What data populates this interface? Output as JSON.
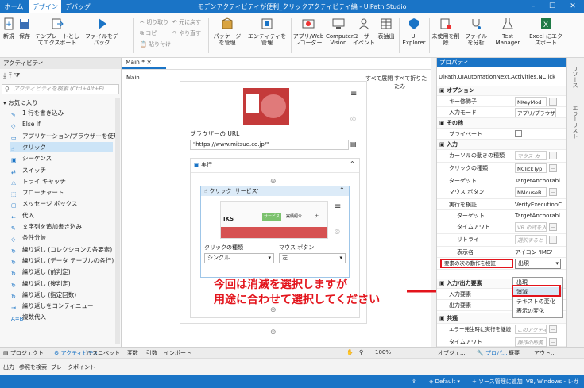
{
  "app": {
    "title": "モデンアクティビティが便利_クリックアクティビティ編 - UiPath Studio",
    "tabs": [
      "ホーム",
      "デザイン",
      "デバッグ"
    ],
    "active_tab": "デザイン"
  },
  "ribbon": {
    "new": "新規",
    "save": "保存",
    "export_template": "テンプレートとしてエクスポート",
    "debug_file": "ファイルをデバッグ",
    "cut": "切り取り",
    "copy": "コピー",
    "paste": "貼り付け",
    "undo": "元に戻す",
    "redo": "やり直す",
    "manage_packages": "パッケージを管理",
    "manage_entities": "エンティティを管理",
    "app_web_recorder": "アプリ/Web レコーダー",
    "computer_vision": "Computer Vision",
    "user_events": "ユーザー イベント",
    "table_extract": "表抽出",
    "ui_explorer": "UI Explorer",
    "remove_unused": "未使用を削除",
    "analyze_file": "ファイルを分析",
    "test_manager": "Test Manager",
    "excel_export": "Excel にエクスポート"
  },
  "activities": {
    "header": "アクティビティ",
    "search_placeholder": "アクティビティを検索 (Ctrl+Alt+F)",
    "favorites": "お気に入り",
    "items": [
      "1 行を書き込み",
      "Else If",
      "アプリケーション/ブラウザーを使用",
      "クリック",
      "シーケンス",
      "スイッチ",
      "トライ キャッチ",
      "フローチャート",
      "メッセージ ボックス",
      "代入",
      "文字列を追加書き込み",
      "条件分岐",
      "繰り返し (コレクションの各要素)",
      "繰り返し (データ テーブルの各行)",
      "繰り返し (前判定)",
      "繰り返し (後判定)",
      "繰り返し (指定回数)",
      "繰り返しをコンティニュー",
      "複数代入"
    ]
  },
  "designer": {
    "doc_tab": "Main *",
    "breadcrumb": "Main",
    "expand_all": "すべて展開",
    "collapse_all": "すべて折りたたみ",
    "browser_url_label": "ブラウザーの URL",
    "browser_url_value": "\"https://www.mitsue.co.jp/\"",
    "do_label": "実行",
    "click_activity_title": "クリック 'サービス'",
    "click_type_label": "クリックの種類",
    "click_type_value": "シングル",
    "mouse_button_label": "マウス ボタン",
    "mouse_button_value": "左",
    "thumb_brand": "IKS",
    "thumb_tabs": [
      "サービス",
      "実績紹介",
      "ナ"
    ],
    "bottom_tabs": [
      "変数",
      "引数",
      "インポート"
    ],
    "zoom": "100%"
  },
  "callout": {
    "line1": "今回は消滅を選択しますが",
    "line2": "用途に合わせて選択してください"
  },
  "properties": {
    "header": "プロパティ",
    "class_name": "UiPath.UIAutomationNext.Activities.NClick",
    "categories": {
      "options": "オプション",
      "misc": "その他",
      "input": "入力",
      "io_elements": "入力/出力要素",
      "common": "共通"
    },
    "rows": {
      "modifier_keys": {
        "label": "キー修飾子",
        "value": "NKeyMod"
      },
      "input_mode": {
        "label": "入力モード",
        "value": "アプリ/ブラウザーと"
      },
      "private": {
        "label": "プライベート"
      },
      "cursor_motion": {
        "label": "カーソルの動きの種類",
        "value": "マウス カーソ"
      },
      "click_type": {
        "label": "クリックの種類",
        "value": "NClickTyp"
      },
      "target": {
        "label": "ターゲット",
        "value": "TargetAnchorabl"
      },
      "mouse_button": {
        "label": "マウス ボタン",
        "value": "NMouseB"
      },
      "verify": {
        "label": "実行を検証",
        "value": "VerifyExecutionC"
      },
      "verify_target": {
        "label": "ターゲット",
        "value": "TargetAnchorabl"
      },
      "timeout": {
        "label": "タイムアウト",
        "value": "VB の式を入力"
      },
      "retry": {
        "label": "リトライ",
        "value": "選択すると"
      },
      "display_name": {
        "label": "表示名",
        "value": "アイコン 'IMG'"
      },
      "element_action": {
        "label": "要素の次の動作を検証",
        "value": "出現"
      },
      "input_element": {
        "label": "入力要素"
      },
      "output_element": {
        "label": "出力要素"
      },
      "continue_on_error": {
        "label": "エラー発生時に実行を継続",
        "value": "このアクティ"
      },
      "timeout2": {
        "label": "タイムアウト",
        "value": "操作の所要"
      }
    },
    "dropdown_options": [
      "出現",
      "消滅",
      "テキストの変化",
      "表示の変化"
    ],
    "selected_option": "消滅"
  },
  "right_strip": [
    "リソース",
    "エラーリスト"
  ],
  "bottom_panel_tabs": [
    "プロジェクト",
    "アクティビティ",
    "スニペット"
  ],
  "props_bottom_tabs": [
    "オブジェ...",
    "プロパ...",
    "概要",
    "アウト..."
  ],
  "output_bar": [
    "出力",
    "参照を検索",
    "ブレークポイント"
  ],
  "status": {
    "left_icon": "upload-icon",
    "env": "Default",
    "vcs": "+ ソース管理に追加",
    "project": "VB, Windows - レガシ"
  },
  "colors": {
    "accent": "#1a74c6",
    "callout": "#e3141c"
  }
}
